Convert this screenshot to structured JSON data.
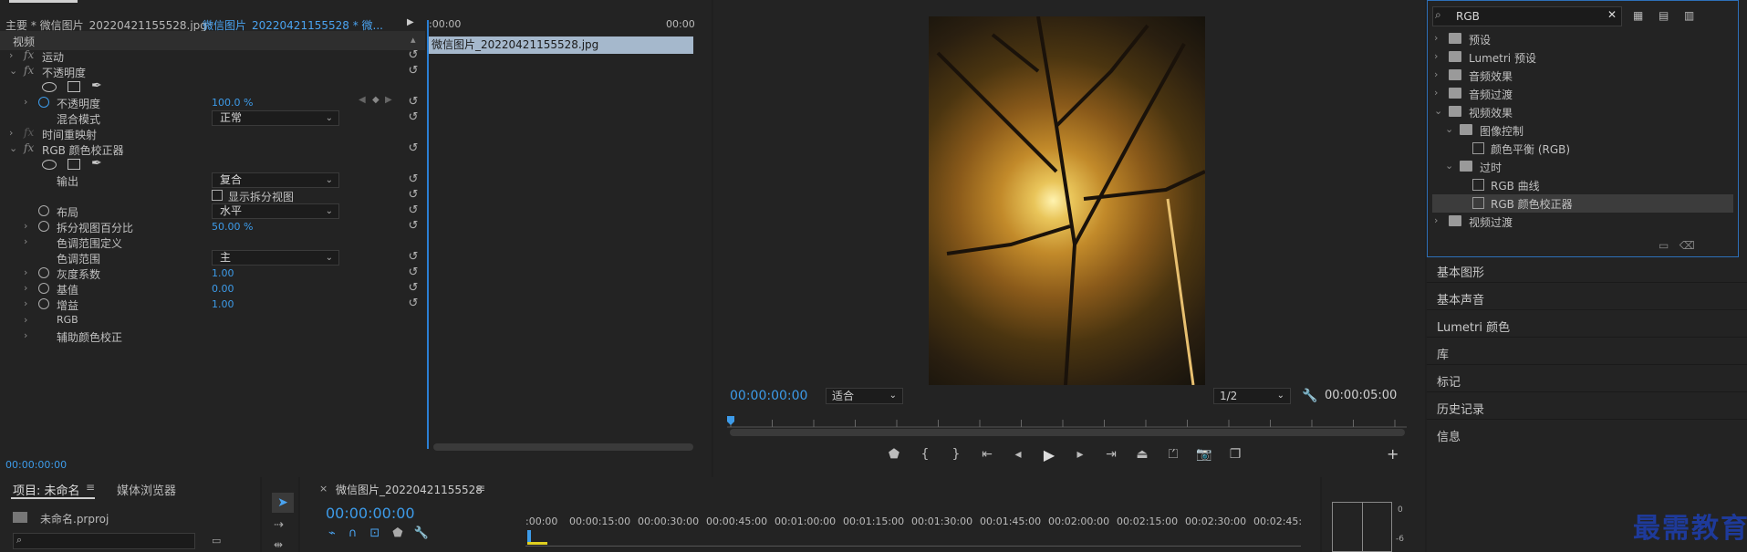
{
  "effect_controls": {
    "source_label": "主要 * 微信图片_20220421155528.jpg",
    "sequence_label": "微信图片_20220421155528 * 微...",
    "ruler_start": ":00:00",
    "ruler_end": "00:00",
    "clip_name": "微信图片_20220421155528.jpg",
    "section_video": "视频",
    "bottom_time": "00:00:00:00",
    "rows": {
      "motion": "运动",
      "opacity_group": "不透明度",
      "opacity": "不透明度",
      "opacity_value": "100.0 %",
      "blend_mode": "混合模式",
      "blend_mode_value": "正常",
      "time_remap": "时间重映射",
      "rgb_corrector": "RGB 颜色校正器",
      "output": "输出",
      "output_value": "复合",
      "show_split": "显示拆分视图",
      "layout": "布局",
      "layout_value": "水平",
      "split_percent": "拆分视图百分比",
      "split_percent_value": "50.00 %",
      "tonal_range_def": "色调范围定义",
      "tonal_range": "色调范围",
      "tonal_range_value": "主",
      "gamma": "灰度系数",
      "gamma_value": "1.00",
      "pedestal": "基值",
      "pedestal_value": "0.00",
      "gain": "增益",
      "gain_value": "1.00",
      "rgb": "RGB",
      "secondary": "辅助颜色校正"
    }
  },
  "program_monitor": {
    "time_left": "00:00:00:00",
    "fit": "适合",
    "resolution": "1/2",
    "time_right": "00:00:05:00"
  },
  "effects_panel": {
    "search_value": "RGB",
    "tree": [
      {
        "label": "预设"
      },
      {
        "label": "Lumetri 预设"
      },
      {
        "label": "音频效果"
      },
      {
        "label": "音频过渡"
      },
      {
        "label": "视频效果"
      },
      {
        "label": "图像控制"
      },
      {
        "label": "颜色平衡 (RGB)"
      },
      {
        "label": "过时"
      },
      {
        "label": "RGB 曲线"
      },
      {
        "label": "RGB 颜色校正器"
      },
      {
        "label": "视频过渡"
      }
    ],
    "panels": [
      "基本图形",
      "基本声音",
      "Lumetri 颜色",
      "库",
      "标记",
      "历史记录",
      "信息"
    ]
  },
  "project": {
    "tab": "项目: 未命名",
    "tab2": "媒体浏览器",
    "file": "未命名.prproj"
  },
  "timeline": {
    "title": "微信图片_20220421155528",
    "time": "00:00:00:00",
    "ticks": [
      ":00:00",
      "00:00:15:00",
      "00:00:30:00",
      "00:00:45:00",
      "00:01:00:00",
      "00:01:15:00",
      "00:01:30:00",
      "00:01:45:00",
      "00:02:00:00",
      "00:02:15:00",
      "00:02:30:00",
      "00:02:45:"
    ]
  },
  "audio_meter": {
    "values": [
      "0",
      "-6"
    ]
  },
  "watermark": "最需教育"
}
